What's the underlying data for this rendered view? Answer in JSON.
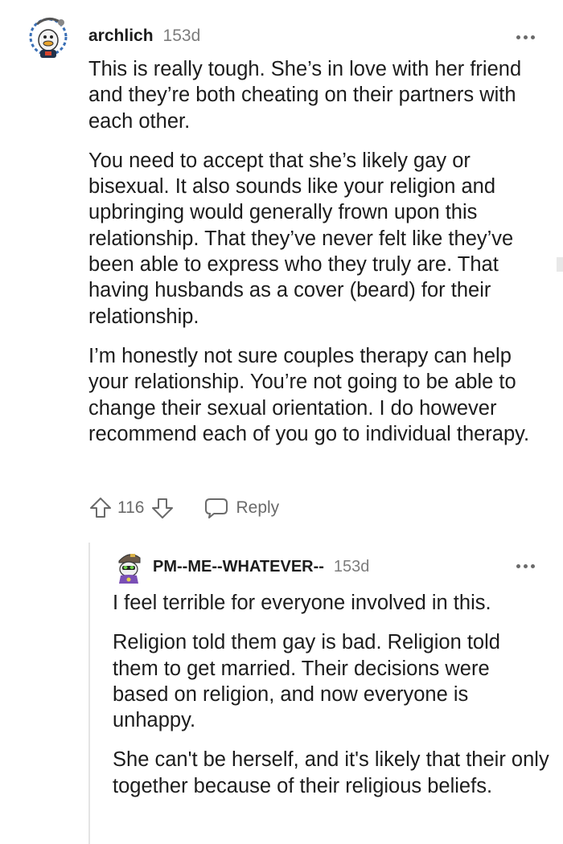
{
  "comment": {
    "username": "archlich",
    "age": "153d",
    "paragraphs": [
      "This is really tough. She’s in love with her friend and they’re both cheating on their partners with each other.",
      "You need to accept that she’s likely gay or bisexual. It also sounds like your religion and upbringing would generally frown upon this relationship. That they’ve never felt like they’ve been able to express who they truly are. That having husbands as a cover (beard) for their relationship.",
      "I’m honestly not sure couples therapy can help your relationship. You’re not going to be able to change their sexual orientation. I do however recommend each of you go to individual therapy."
    ],
    "votes": "116",
    "reply_label": "Reply",
    "avatar_icon": "snoo-avatar-icon"
  },
  "reply": {
    "username": "PM--ME--WHATEVER--",
    "age": "153d",
    "paragraphs": [
      "I feel terrible for everyone involved in this.",
      "Religion told them gay is bad. Religion told them to get married. Their decisions were based on religion, and now everyone is unhappy.",
      "She can't be herself, and it's likely that their only together because of their religious beliefs."
    ],
    "avatar_icon": "snoo-avatar-icon"
  },
  "colors": {
    "text": "#1c1c1c",
    "muted": "#7c7c7c",
    "icon": "#6a6a6a",
    "thread_line": "#e4e4e4"
  }
}
